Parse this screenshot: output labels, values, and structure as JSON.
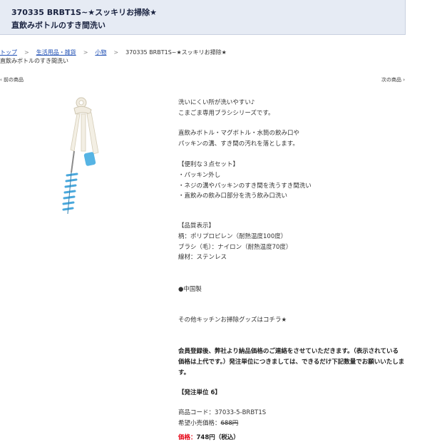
{
  "header": {
    "line1": "370335 BRBT1S~★スッキリお掃除★",
    "line2": "直飲みボトルのすき間洗い"
  },
  "breadcrumb": {
    "items": [
      "トップ",
      "生活用品・雑貨",
      "小物"
    ],
    "current": "370335 BRBT1S~★スッキリお掃除★",
    "current_line2": "直飲みボトルのすき間洗い"
  },
  "nav": {
    "prev": "前の商品",
    "next": "次の商品"
  },
  "description": [
    "洗いにくい所が洗いやすい♪",
    "こまごま専用ブラシシリーズです。",
    "直飲みボトル・マグボトル・水筒の飲み口や",
    "パッキンの溝、すき間の汚れを落とします。",
    "【便利な３点セット】",
    "・パッキン外し",
    "・ネジの溝やパッキンのすき間を洗うすき間洗い",
    "・直飲みの飲み口部分を洗う飲み口洗い",
    "【品質表示】",
    "柄：ポリプロピレン（耐熱温度100度）",
    "ブラシ（毛）：ナイロン（耐熱温度70度）",
    "線材：ステンレス",
    "●中国製",
    "その他キッチンお掃除グッズはコチラ★"
  ],
  "member_notice": {
    "line1": "会員登録後、弊社より納品価格のご連絡をさせていただきます。（表示されている",
    "line2": "価格は上代です。）発注単位につきましては、できるだけ下記数量でお願いいたしま",
    "line3": "す。"
  },
  "order_unit": "【発注単位 6】",
  "product_code_label": "商品コード：",
  "product_code": "37033-5-BRBT1S",
  "msrp_label": "希望小売価格：",
  "msrp": "688円",
  "price_label": "価格：",
  "price": "748円（税込）",
  "colors": {
    "price_red": "#e60012",
    "header_bg": "#e6ebf4",
    "link_blue": "#1f4fb4",
    "brush_blue": "#4aa8dc"
  },
  "icons": {
    "product": "brush-product-image"
  }
}
